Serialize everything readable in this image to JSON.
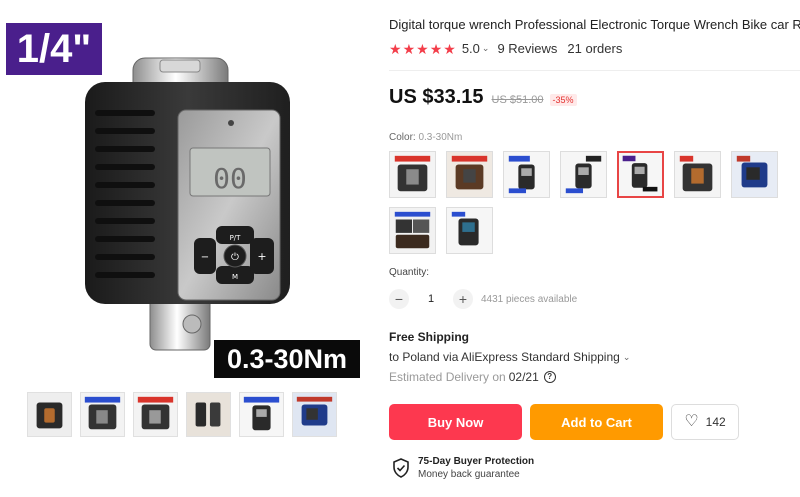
{
  "gallery": {
    "size_badge": "1/4\"",
    "range_badge": "0.3-30Nm",
    "display_readout": "00",
    "keypad": {
      "up": "P/T",
      "left": "−",
      "center": "⏻",
      "right": "+",
      "down": "M"
    },
    "thumbnails": [
      {
        "icon": "case-thumbnail"
      },
      {
        "icon": "case-blue-thumbnail"
      },
      {
        "icon": "case-red-label-thumbnail"
      },
      {
        "icon": "adapters-thumbnail"
      },
      {
        "icon": "digital-adapter-thumbnail"
      },
      {
        "icon": "kit-thumbnail"
      }
    ]
  },
  "product": {
    "title": "Digital torque wrench Professional Electronic Torque Wrench Bike car Repair",
    "rating": "5.0",
    "reviews": "9 Reviews",
    "orders": "21 orders",
    "stars": 5
  },
  "price": {
    "current": "US $33.15",
    "original": "US $51.00",
    "discount": "-35%"
  },
  "color": {
    "label": "Color: ",
    "value": "0.3-30Nm",
    "selected_index": 4,
    "options": [
      {
        "name": "case-red-label"
      },
      {
        "name": "digital-adapter-kit"
      },
      {
        "name": "digital-adapter-blue"
      },
      {
        "name": "pcs-set"
      },
      {
        "name": "0.3-30Nm"
      },
      {
        "name": "case-open"
      },
      {
        "name": "blue-display"
      },
      {
        "name": "full-kit"
      },
      {
        "name": "blue-unit"
      }
    ]
  },
  "quantity": {
    "label": "Quantity:",
    "minus": "−",
    "value": "1",
    "plus": "+",
    "available": "4431 pieces available"
  },
  "shipping": {
    "title": "Free Shipping",
    "line": "to Poland via AliExpress Standard Shipping",
    "estimated_label": "Estimated Delivery on",
    "estimated_date": "02/21",
    "help": "?"
  },
  "actions": {
    "buy_now": "Buy Now",
    "add_to_cart": "Add to Cart",
    "wishlist_count": "142"
  },
  "protection": {
    "title": "75-Day Buyer Protection",
    "subtitle": "Money back guarantee"
  },
  "colors": {
    "star": "#f33e4a",
    "buy": "#fd384f",
    "cart": "#ff9a00",
    "size_badge": "#4a1f8c",
    "selected_border": "#e84545"
  }
}
